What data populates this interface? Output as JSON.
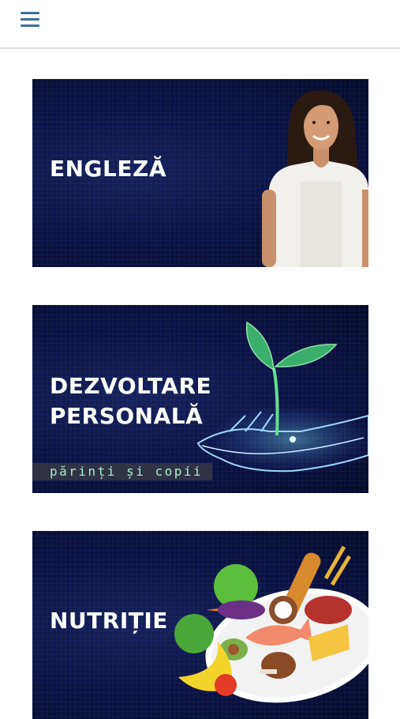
{
  "header": {
    "menu_icon": "hamburger-menu-icon",
    "accent_color": "#3b6f9a"
  },
  "cards": [
    {
      "title": "ENGLEZĂ",
      "image": "woman-portrait"
    },
    {
      "title_line1": "DEZVOLTARE",
      "title_line2": "PERSONALĂ",
      "subtitle": "părinți și copii",
      "image": "glowing-plant-in-hand"
    },
    {
      "title": "NUTRIȚIE",
      "image": "food-plate"
    }
  ]
}
